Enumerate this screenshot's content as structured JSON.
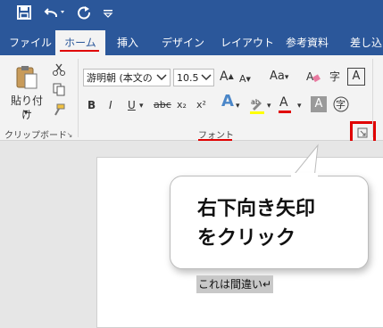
{
  "qat": {
    "save_icon": "save-icon",
    "undo_icon": "undo-icon",
    "redo_icon": "repeat-icon",
    "customize_icon": "customize-icon"
  },
  "tabs": [
    {
      "label": "ファイル"
    },
    {
      "label": "ホーム"
    },
    {
      "label": "挿入"
    },
    {
      "label": "デザイン"
    },
    {
      "label": "レイアウト"
    },
    {
      "label": "参考資料"
    },
    {
      "label": "差し込"
    }
  ],
  "clipboard": {
    "paste_label": "貼り付け",
    "paste_dropdown": "▾",
    "group_label": "クリップボード"
  },
  "font": {
    "font_name": "游明朝 (本文の",
    "font_size": "10.5",
    "group_label": "フォント",
    "aa_label": "Aa",
    "bold": "B",
    "italic": "I",
    "underline": "U",
    "strike": "abc",
    "subscript": "x₂",
    "superscript": "x²",
    "text_a": "A",
    "big_a": "A",
    "char_shade": "A",
    "phonetic": "字"
  },
  "callout": {
    "line1": "右下向き矢印",
    "line2": "をクリック"
  },
  "doc": {
    "text": "これは間違い↵"
  },
  "colors": {
    "accent": "#2b579a",
    "red": "#e00000"
  }
}
